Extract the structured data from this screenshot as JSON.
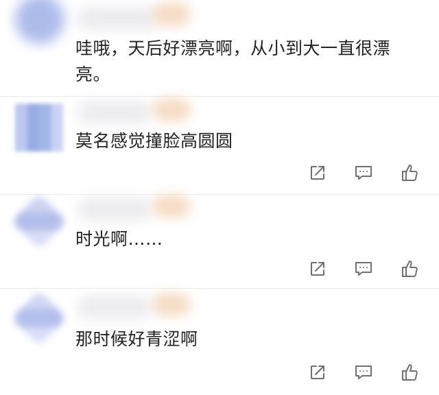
{
  "comments": [
    {
      "text": "哇哦，天后好漂亮啊，从小到大一直很漂亮。",
      "avatar_color": "#9fb0e6",
      "show_actions": false
    },
    {
      "text": "莫名感觉撞脸高圆圆",
      "avatar_color": "#8ea5e2",
      "show_actions": true
    },
    {
      "text": "时光啊……",
      "avatar_color": "#a9b3e8",
      "show_actions": true
    },
    {
      "text": "那时候好青涩啊",
      "avatar_color": "#a8b5ea",
      "show_actions": true
    }
  ],
  "icons": {
    "share": "share-icon",
    "reply": "comment-icon",
    "like": "thumbs-up-icon"
  },
  "colors": {
    "text": "#222222",
    "icon": "#6f6f6f",
    "name_blur": "#e9e9ec",
    "badge_blur": "#f6dcc4"
  }
}
